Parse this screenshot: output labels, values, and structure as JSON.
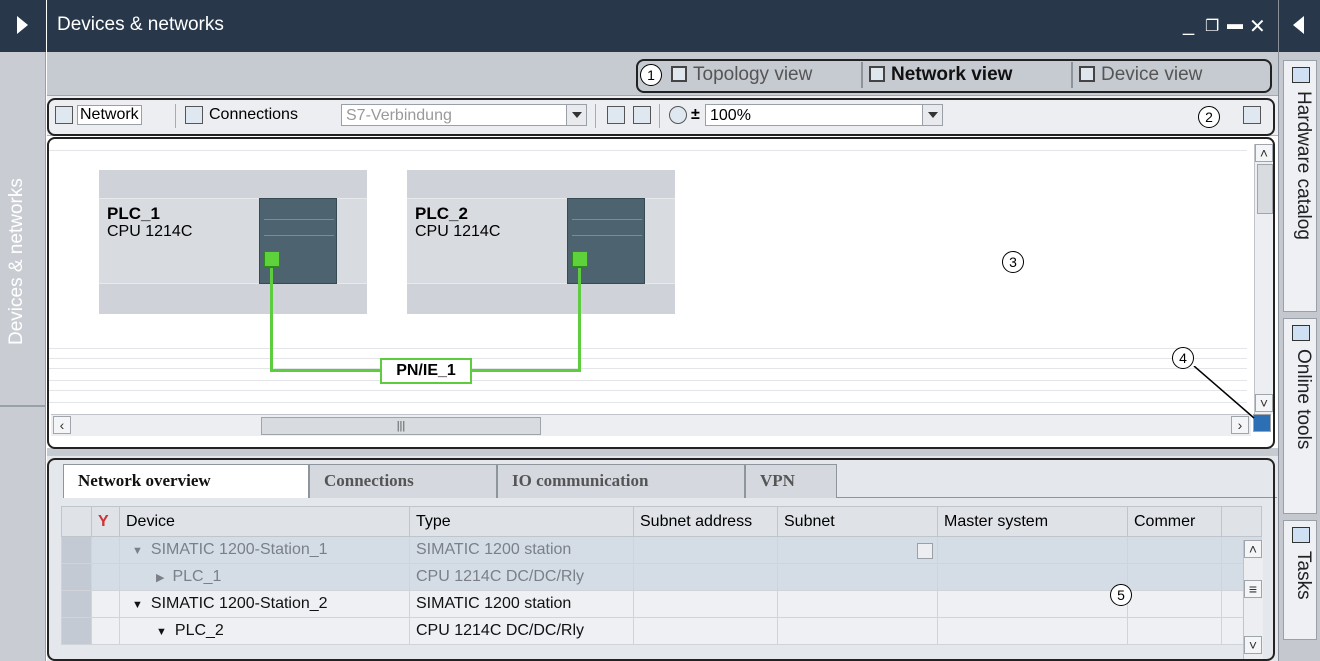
{
  "sidebar_left": {
    "label": "Devices & networks"
  },
  "window": {
    "title": "Devices & networks",
    "controls": [
      "_",
      "❐",
      "▬",
      "✕"
    ]
  },
  "views": {
    "topology": "Topology view",
    "network": "Network view",
    "device": "Device view"
  },
  "toolbar": {
    "network_label": "Network",
    "connections_label": "Connections",
    "connection_type": "S7-Verbindung",
    "zoom": "100%"
  },
  "canvas": {
    "devices": [
      {
        "name": "PLC_1",
        "type": "CPU 1214C"
      },
      {
        "name": "PLC_2",
        "type": "CPU 1214C"
      }
    ],
    "subnet": "PN/IE_1",
    "accent_green": "#5dcc3f"
  },
  "overview": {
    "tabs": [
      "Network overview",
      "Connections",
      "IO communication",
      "VPN"
    ],
    "columns": [
      "Device",
      "Type",
      "Subnet address",
      "Subnet",
      "Master system",
      "Commer"
    ],
    "rows": [
      {
        "device": "SIMATIC 1200-Station_1",
        "type": "SIMATIC 1200 station",
        "expander": "▼"
      },
      {
        "device": "PLC_1",
        "type": "CPU 1214C DC/DC/Rly",
        "expander": "▶"
      },
      {
        "device": "SIMATIC 1200-Station_2",
        "type": "SIMATIC 1200 station",
        "expander": "▼"
      },
      {
        "device": "PLC_2",
        "type": "CPU 1214C DC/DC/Rly",
        "expander": "▼"
      }
    ]
  },
  "sidebar_right": {
    "tabs": [
      "Hardware catalog",
      "Online tools",
      "Tasks"
    ]
  },
  "callouts": [
    "1",
    "2",
    "3",
    "4",
    "5"
  ]
}
